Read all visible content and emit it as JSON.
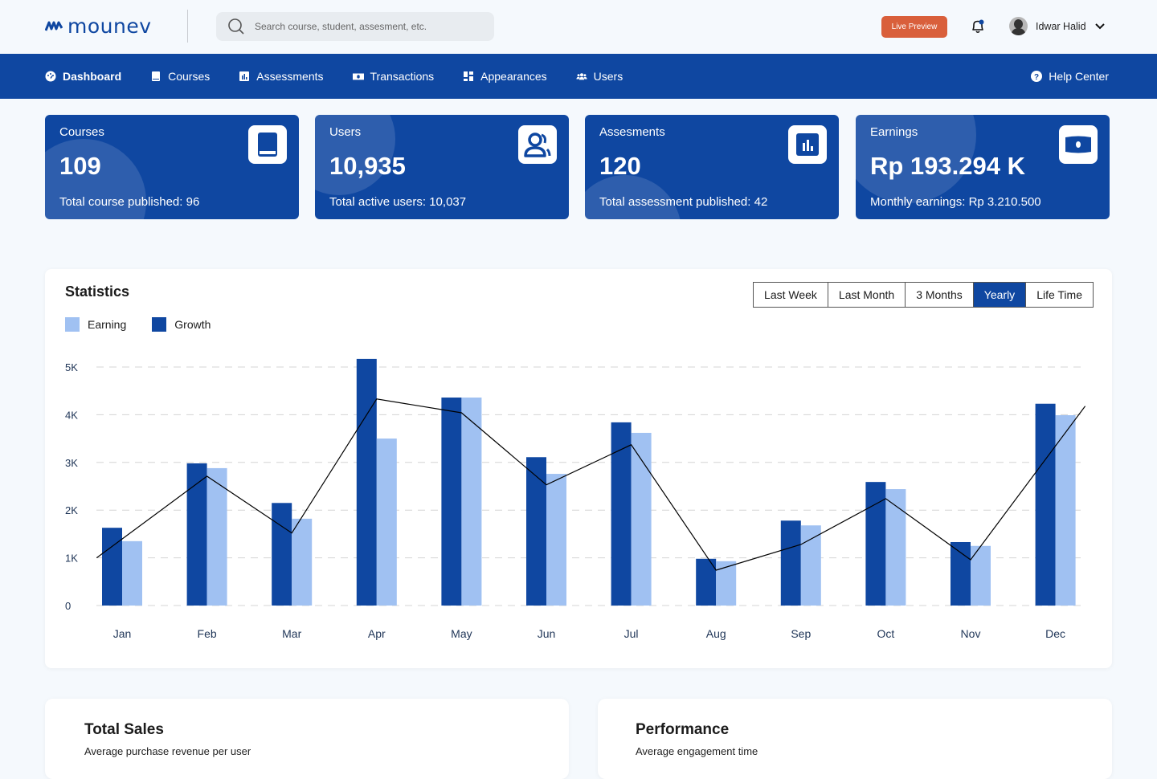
{
  "brand": {
    "name": "mounev",
    "color": "#0f47a1"
  },
  "header": {
    "search_placeholder": "Search course, student, assesment, etc.",
    "live_preview_label": "Live Preview",
    "live_preview_color": "#d95f3b",
    "user_name": "Idwar Halid",
    "notification_icon": "bell-icon",
    "has_unread_notifications": true
  },
  "nav": {
    "items": [
      {
        "label": "Dashboard",
        "icon": "gauge-icon",
        "active": true
      },
      {
        "label": "Courses",
        "icon": "book-icon",
        "active": false
      },
      {
        "label": "Assessments",
        "icon": "chart-bar-icon",
        "active": false
      },
      {
        "label": "Transactions",
        "icon": "money-bill-icon",
        "active": false
      },
      {
        "label": "Appearances",
        "icon": "layout-icon",
        "active": false
      },
      {
        "label": "Users",
        "icon": "users-icon",
        "active": false
      }
    ],
    "help_label": "Help Center"
  },
  "stat_cards": [
    {
      "title": "Courses",
      "value": "109",
      "subtitle": "Total course published: 96",
      "icon": "book-icon"
    },
    {
      "title": "Users",
      "value": "10,935",
      "subtitle": "Total active users: 10,037",
      "icon": "users-icon"
    },
    {
      "title": "Assesments",
      "value": "120",
      "subtitle": "Total assessment published: 42",
      "icon": "chart-bar-icon"
    },
    {
      "title": "Earnings",
      "value": "Rp 193.294 K",
      "subtitle": "Monthly earnings: Rp 3.210.500",
      "icon": "money-bill-icon"
    }
  ],
  "statistics": {
    "title": "Statistics",
    "ranges": [
      {
        "label": "Last Week",
        "active": false
      },
      {
        "label": "Last Month",
        "active": false
      },
      {
        "label": "3 Months",
        "active": false
      },
      {
        "label": "Yearly",
        "active": true
      },
      {
        "label": "Life Time",
        "active": false
      }
    ]
  },
  "chart_data": {
    "type": "bar",
    "title": "Statistics",
    "xlabel": "",
    "ylabel": "",
    "categories": [
      "Jan",
      "Feb",
      "Mar",
      "Apr",
      "May",
      "Jun",
      "Jul",
      "Aug",
      "Sep",
      "Oct",
      "Nov",
      "Dec"
    ],
    "series": [
      {
        "name": "Growth",
        "type": "bar",
        "color": "#0f47a1",
        "values": [
          1630,
          2980,
          2150,
          5170,
          4360,
          3110,
          3840,
          980,
          1780,
          2590,
          1330,
          4230
        ]
      },
      {
        "name": "Earning",
        "type": "bar",
        "color": "#a0c1f2",
        "values": [
          1350,
          2880,
          1820,
          3500,
          4360,
          2760,
          3620,
          930,
          1680,
          2440,
          1250,
          3990
        ]
      },
      {
        "name": "Trend",
        "type": "line",
        "color": "#000000",
        "points": [
          {
            "x": -0.3,
            "y": 1000
          },
          {
            "x": 1,
            "y": 2710
          },
          {
            "x": 2,
            "y": 1520
          },
          {
            "x": 3,
            "y": 4330
          },
          {
            "x": 4,
            "y": 4040
          },
          {
            "x": 5,
            "y": 2530
          },
          {
            "x": 6,
            "y": 3370
          },
          {
            "x": 7,
            "y": 740
          },
          {
            "x": 8,
            "y": 1280
          },
          {
            "x": 9,
            "y": 2240
          },
          {
            "x": 10,
            "y": 960
          },
          {
            "x": 11.35,
            "y": 4180
          }
        ]
      }
    ],
    "legend": [
      {
        "label": "Earning",
        "color": "#a0c1f2"
      },
      {
        "label": "Growth",
        "color": "#0f47a1"
      }
    ],
    "legend_position": "top-left",
    "ylim": [
      0,
      5000
    ],
    "yticks": [
      0,
      1000,
      2000,
      3000,
      4000,
      5000
    ],
    "ytick_labels": [
      "0",
      "1K",
      "2K",
      "3K",
      "4K",
      "5K"
    ],
    "grid": true
  },
  "bottom_cards": [
    {
      "title": "Total Sales",
      "subtitle": "Average purchase revenue per user"
    },
    {
      "title": "Performance",
      "subtitle": "Average engagement time"
    }
  ]
}
